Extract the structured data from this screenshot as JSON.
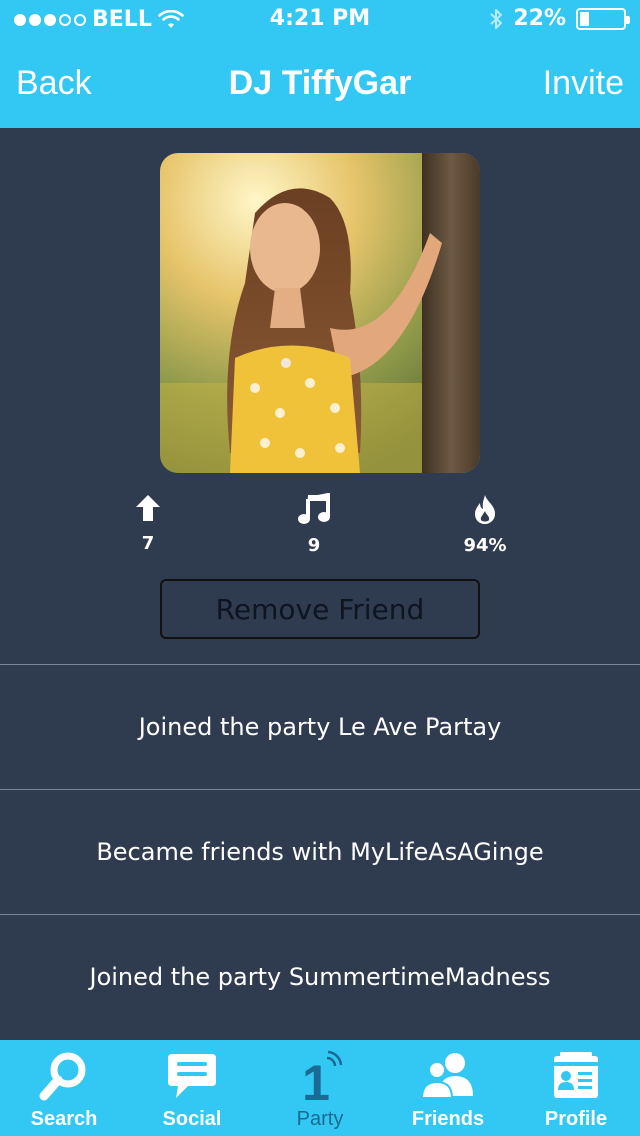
{
  "status_bar": {
    "carrier": "BELL",
    "time": "4:21 PM",
    "battery": "22%",
    "battery_fraction": 0.22,
    "signal_bars": 3,
    "signal_total": 5
  },
  "nav": {
    "back_label": "Back",
    "title": "DJ TiffyGar",
    "invite_label": "Invite"
  },
  "profile": {
    "photo_icon": "profile-photo",
    "stats": [
      {
        "icon": "upvote-arrow-icon",
        "value": "7"
      },
      {
        "icon": "music-note-icon",
        "value": "9"
      },
      {
        "icon": "flame-icon",
        "value": "94%"
      }
    ],
    "remove_friend_label": "Remove Friend"
  },
  "activity": [
    "Joined the party Le Ave Partay",
    "Became friends with MyLifeAsAGinge",
    "Joined the party SummertimeMadness"
  ],
  "tabbar": {
    "tabs": [
      {
        "label": "Search",
        "icon": "search-icon"
      },
      {
        "label": "Social",
        "icon": "chat-bubble-icon"
      },
      {
        "label": "Party",
        "icon": "party-number-icon",
        "active": true,
        "number": "1"
      },
      {
        "label": "Friends",
        "icon": "friends-icon"
      },
      {
        "label": "Profile",
        "icon": "profile-card-icon"
      }
    ]
  },
  "colors": {
    "accent": "#33c8f3",
    "background": "#2f3b4f",
    "active_tab": "#1a6a93"
  }
}
